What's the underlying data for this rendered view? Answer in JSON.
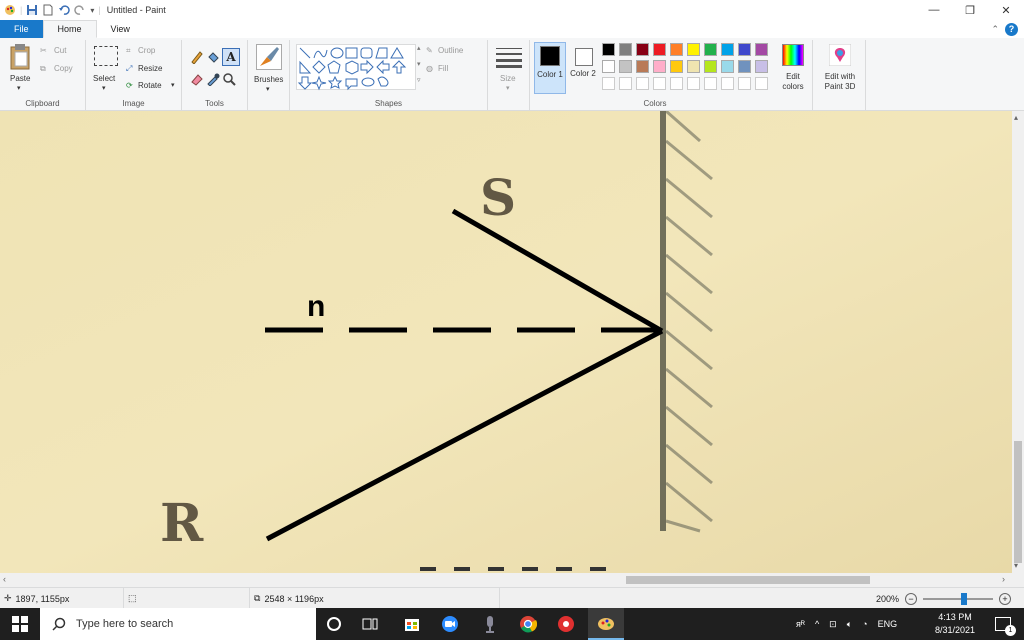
{
  "window": {
    "title": "Untitled - Paint"
  },
  "tabs": [
    {
      "label": "File"
    },
    {
      "label": "Home"
    },
    {
      "label": "View"
    }
  ],
  "ribbon": {
    "clipboard": {
      "group_label": "Clipboard",
      "paste": "Paste",
      "cut": "Cut",
      "copy": "Copy"
    },
    "image": {
      "group_label": "Image",
      "select": "Select",
      "crop": "Crop",
      "resize": "Resize",
      "rotate": "Rotate"
    },
    "tools": {
      "group_label": "Tools"
    },
    "brushes": {
      "label": "Brushes"
    },
    "shapes": {
      "group_label": "Shapes",
      "outline": "Outline",
      "fill": "Fill"
    },
    "size": {
      "label": "Size"
    },
    "colors": {
      "group_label": "Colors",
      "color1": "Color 1",
      "color2": "Color 2",
      "edit_colors": "Edit colors",
      "edit_3d": "Edit with Paint 3D",
      "palette_row1": [
        "#000000",
        "#7f7f7f",
        "#880015",
        "#ed1c24",
        "#ff7f27",
        "#fff200",
        "#22b14c",
        "#00a2e8",
        "#3f48cc",
        "#a349a4"
      ],
      "palette_row2": [
        "#ffffff",
        "#c3c3c3",
        "#b97a57",
        "#ffaec9",
        "#ffc90e",
        "#efe4b0",
        "#b5e61d",
        "#99d9ea",
        "#7092be",
        "#c8bfe7"
      ]
    }
  },
  "canvas": {
    "label_s": "S",
    "label_n": "n",
    "label_r": "R"
  },
  "status": {
    "cursor_pos": "1897, 1155px",
    "image_size": "2548 × 1196px",
    "zoom": "200%"
  },
  "taskbar": {
    "search_placeholder": "Type here to search",
    "time": "4:13 PM",
    "date": "8/31/2021",
    "lang": "ENG",
    "notification_count": "1"
  }
}
